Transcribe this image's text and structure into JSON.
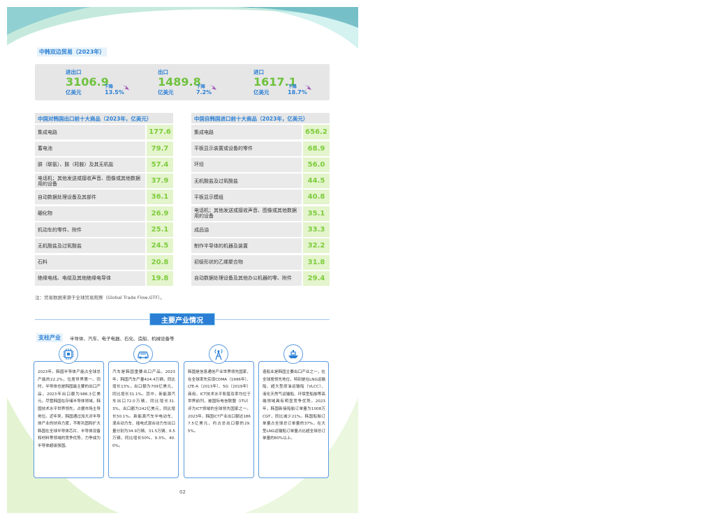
{
  "section_title": "中韩双边贸易（2023年）",
  "summary": [
    {
      "label": "进出口",
      "value": "3106.9",
      "unit": "亿美元",
      "down": "下降",
      "pct": "13.5%"
    },
    {
      "label": "出口",
      "value": "1489.8",
      "unit": "亿美元",
      "down": "下降",
      "pct": "7.2%"
    },
    {
      "label": "进口",
      "value": "1617.1",
      "unit": "亿美元",
      "down": "下降",
      "pct": "18.7%"
    }
  ],
  "export_table": {
    "title": "中国对韩国出口前十大商品（2023年，亿美元）",
    "rows": [
      {
        "name": "集成电路",
        "value": "177.6"
      },
      {
        "name": "蓄电池",
        "value": "79.7"
      },
      {
        "name": "肼（联氨）、胲（羟胺）及其无机盐",
        "value": "57.4"
      },
      {
        "name": "电话机；其他发送或接收声音、图像或其他数据用的设备",
        "value": "37.9"
      },
      {
        "name": "自动数据处理设备及其部件",
        "value": "36.1"
      },
      {
        "name": "硼化物",
        "value": "26.9"
      },
      {
        "name": "机动车的零件、附件",
        "value": "25.1"
      },
      {
        "name": "无机酸盐及过氧酸盐",
        "value": "24.5"
      },
      {
        "name": "石料",
        "value": "20.8"
      },
      {
        "name": "绝缘电线、电缆及其他绝缘电导体",
        "value": "19.8"
      }
    ]
  },
  "import_table": {
    "title": "中国自韩国进口前十大商品（2023年，亿美元）",
    "rows": [
      {
        "name": "集成电路",
        "value": "656.2"
      },
      {
        "name": "平板显示装置或设备的零件",
        "value": "68.9"
      },
      {
        "name": "环烃",
        "value": "56.0"
      },
      {
        "name": "无机酸盐及过氧酸盐",
        "value": "44.5"
      },
      {
        "name": "平板显示模组",
        "value": "40.8"
      },
      {
        "name": "电话机；其他发送或接收声音、图像或其他数据用的设备",
        "value": "35.1"
      },
      {
        "name": "成品油",
        "value": "33.3"
      },
      {
        "name": "制作半导体的机器及装置",
        "value": "32.2"
      },
      {
        "name": "初级形状的乙烯聚合物",
        "value": "31.8"
      },
      {
        "name": "自动数据处理设备及其他办公机器的零、附件",
        "value": "29.4"
      }
    ]
  },
  "note": "注：贸易数据来源于全球贸易观察（Global Trade Flow,GTF）。",
  "banner": "主要产业情况",
  "pillar": {
    "label": "支柱产业",
    "items": "半导体、汽车、电子电器、石化、造船、机械设备等"
  },
  "cards": [
    {
      "icon": "chip-icon",
      "text": "2023年，韩国半导体产能占全球总产能的22.2%，位居世界第一。同时，半导体也是韩国最主要的出口产品，2023年出口额为986.3亿美元。尽管韩国在存储半导体领域，韩国技术水平世界领先，占据市场主导地位。近年来，韩国通过加大对半导体产业的扶持力度，不断巩固和扩大韩国在全球半导体芯片、半导体设备和材料等领域的竞争优势，力争成为半导体超级强国。"
    },
    {
      "icon": "car-icon",
      "text": "汽车是韩国重要出口产品。2023年，韩国汽车产量424.4万辆，同比增长13%，出口额为709亿美元，同比增长31.1%。其中，新能源汽车出口72.0万辆，同比增长31.3%，出口额为242亿美元，同比增长50.1%。新能源汽车中电动车、混合动力车、插电式混合动力车出口量分别为34.9万辆、31.5万辆、6.5万辆，同比增长50%、9.3%、40.0%。"
    },
    {
      "icon": "signal-tower-icon",
      "text": "韩国是信息通信产业世界领先国家，在全球率先实现CDMA（1996年）、LTE-A（2013年）、5G（2019年）商用，ICT技术水平和普及率均位于世界前列，被国际电信联盟（ITU）评为ICT领域的全球领先国家之一。2023年，韩国ICT产业出口额达1867.5亿美元，约占总出口额的29.5%。"
    },
    {
      "icon": "ship-icon",
      "text": "造船业是韩国主要出口产业之一，在全球居领先地位，特别是在LNG运输船、超大型原油运输船（VLCC）、液化天然气运输船、环保型船舶等高端领域具有明显竞争优势。2023年，韩国新接船舶订单量为1008万CGT，同比减少21%。韩国船舶订单量占全球总订单量的37%，在大型LNG运输船订单量占比超全球总订单量的80%以上。"
    }
  ],
  "page_number": "02",
  "colors": {
    "accent": "#2a7fd4",
    "value_green": "#7ccc3c",
    "table_bg": "#eaeaea"
  }
}
